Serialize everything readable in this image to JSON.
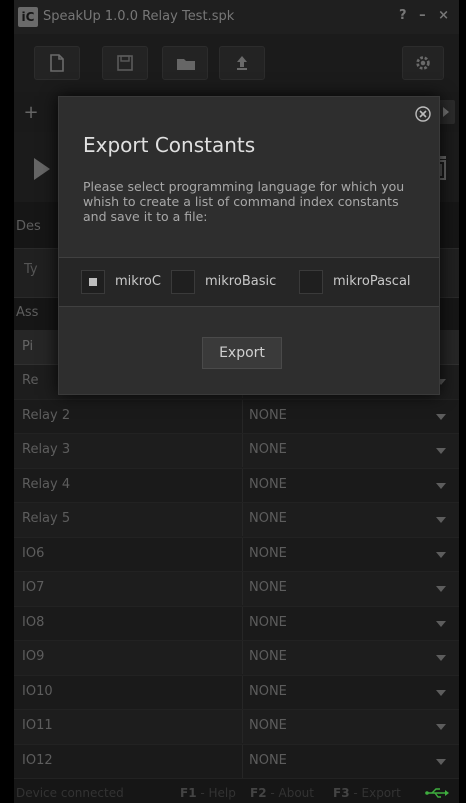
{
  "window": {
    "logo": "iC",
    "title": "SpeakUp 1.0.0  Relay Test.spk",
    "controls": "? – ×"
  },
  "tabs": {
    "add": "+"
  },
  "form": {
    "description_label": "Des",
    "type_label": "Ty",
    "assign_label": "Ass"
  },
  "table": {
    "header_name": "Pi",
    "rows": [
      {
        "name": "Re",
        "value": ""
      },
      {
        "name": "Relay 2",
        "value": "NONE"
      },
      {
        "name": "Relay 3",
        "value": "NONE"
      },
      {
        "name": "Relay 4",
        "value": "NONE"
      },
      {
        "name": "Relay 5",
        "value": "NONE"
      },
      {
        "name": "IO6",
        "value": "NONE"
      },
      {
        "name": "IO7",
        "value": "NONE"
      },
      {
        "name": "IO8",
        "value": "NONE"
      },
      {
        "name": "IO9",
        "value": "NONE"
      },
      {
        "name": "IO10",
        "value": "NONE"
      },
      {
        "name": "IO11",
        "value": "NONE"
      },
      {
        "name": "IO12",
        "value": "NONE"
      }
    ]
  },
  "status": {
    "connection": "Device connected",
    "f1_key": "F1",
    "f1_label": " - Help",
    "f2_key": "F2",
    "f2_label": " - About",
    "f3_key": "F3",
    "f3_label": " - Export"
  },
  "dialog": {
    "title": "Export Constants",
    "message": "Please select programming language for which you whish to create a list of command index constants and save it to a file:",
    "options": [
      {
        "label": "mikroC",
        "checked": true
      },
      {
        "label": "mikroBasic",
        "checked": false
      },
      {
        "label": "mikroPascal",
        "checked": false
      }
    ],
    "export_label": "Export"
  },
  "colors": {
    "background": "#161616",
    "dialog": "#2e2e2e",
    "accent_usb": "#3fae3f"
  }
}
